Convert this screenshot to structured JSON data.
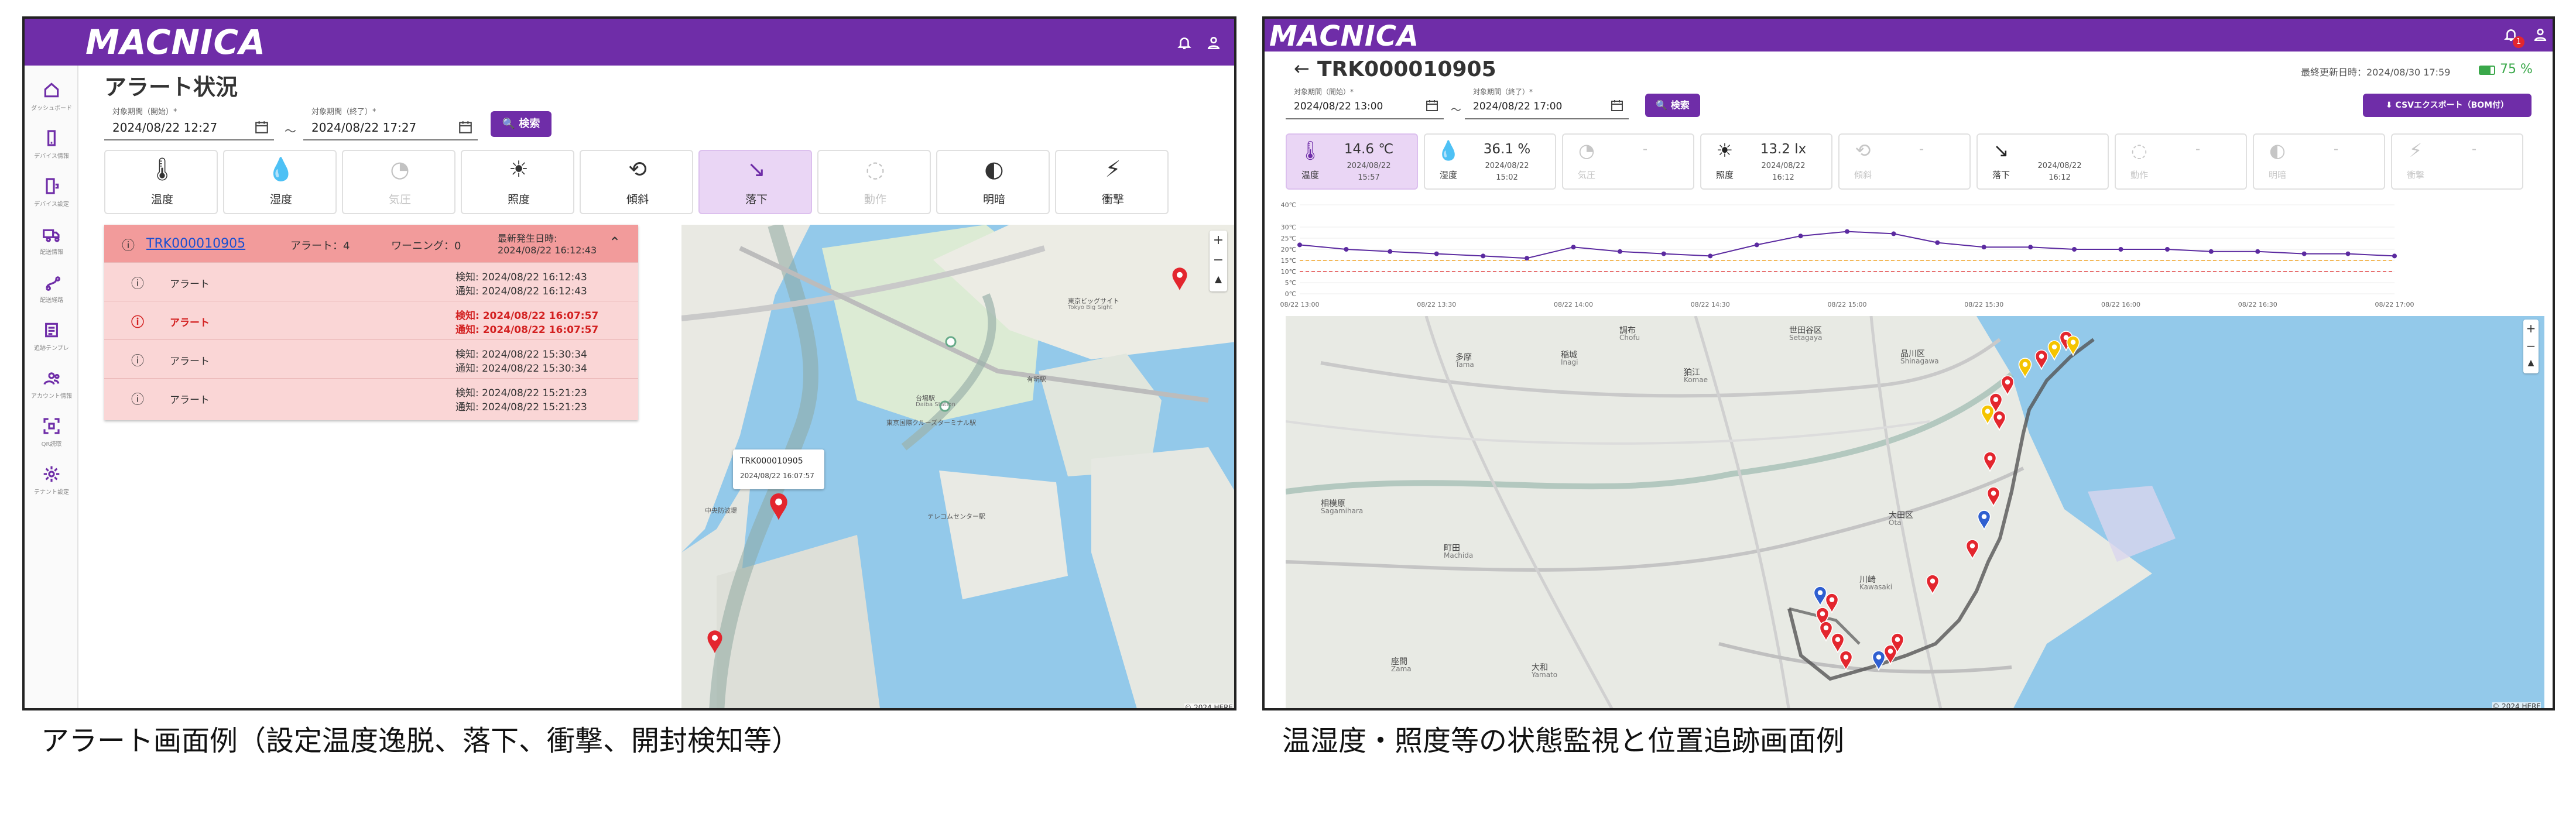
{
  "left": {
    "brand": "MACNICA",
    "page_title": "アラート状況",
    "sidebar": [
      {
        "label": "ダッシュボード",
        "icon": "home-icon"
      },
      {
        "label": "デバイス情報",
        "icon": "phone-icon"
      },
      {
        "label": "デバイス設定",
        "icon": "device-settings-icon"
      },
      {
        "label": "配送情報",
        "icon": "truck-icon"
      },
      {
        "label": "配送経路",
        "icon": "route-icon"
      },
      {
        "label": "追跡テンプレ",
        "icon": "template-icon"
      },
      {
        "label": "アカウント情報",
        "icon": "accounts-icon"
      },
      {
        "label": "QR読取",
        "icon": "qr-scan-icon"
      },
      {
        "label": "テナント設定",
        "icon": "gear-icon"
      }
    ],
    "start": {
      "label": "対象期間（開始）*",
      "value": "2024/08/22 12:27"
    },
    "end": {
      "label": "対象期間（終了）*",
      "value": "2024/08/22 17:27"
    },
    "tilde": "〜",
    "search_label": "検索",
    "tiles": [
      {
        "label": "温度",
        "glyph": "🌡",
        "icon": "thermometer-icon"
      },
      {
        "label": "湿度",
        "glyph": "💧",
        "icon": "humidity-icon"
      },
      {
        "label": "気圧",
        "glyph": "◔",
        "icon": "pressure-icon"
      },
      {
        "label": "照度",
        "glyph": "☀",
        "icon": "illuminance-icon"
      },
      {
        "label": "傾斜",
        "glyph": "⟲",
        "icon": "tilt-icon"
      },
      {
        "label": "落下",
        "glyph": "↘",
        "icon": "drop-icon"
      },
      {
        "label": "動作",
        "glyph": "◌",
        "icon": "motion-icon"
      },
      {
        "label": "明暗",
        "glyph": "◐",
        "icon": "light-dark-icon"
      },
      {
        "label": "衝撃",
        "glyph": "⚡",
        "icon": "shock-icon"
      }
    ],
    "alert": {
      "tracker": "TRK000010905",
      "alert_count": "アラート：4",
      "warning_count": "ワーニング：0",
      "latest_label": "最新発生日時:",
      "latest_value": "2024/08/22 16:12:43",
      "rows": [
        {
          "name": "アラート",
          "detect": "検知: 2024/08/22 16:12:43",
          "notify": "通知: 2024/08/22 16:12:43",
          "highlight": false
        },
        {
          "name": "アラート",
          "detect": "検知: 2024/08/22 16:07:57",
          "notify": "通知: 2024/08/22 16:07:57",
          "highlight": true
        },
        {
          "name": "アラート",
          "detect": "検知: 2024/08/22 15:30:34",
          "notify": "通知: 2024/08/22 15:30:34",
          "highlight": false
        },
        {
          "name": "アラート",
          "detect": "検知: 2024/08/22 15:21:23",
          "notify": "通知: 2024/08/22 15:21:23",
          "highlight": false
        }
      ]
    },
    "map": {
      "popup_title": "TRK000010905",
      "popup_time": "2024/08/22 16:07:57",
      "labels": [
        "台場駅",
        "Daiba Station",
        "東京ビッグサイト",
        "Tokyo Big Sight",
        "有明駅",
        "東京国際クルーズターミナル駅",
        "テレコムセンター駅",
        "中央防波堤"
      ],
      "attribution": "© 2024 HERE"
    },
    "caption": "アラート画面例（設定温度逸脱、落下、衝撃、開封検知等）"
  },
  "right": {
    "brand": "MACNICA",
    "tracker_title": "TRK000010905",
    "last_update": "最終更新日時：2024/08/30 17:59",
    "battery": "75 %",
    "notif_count": "1",
    "start": {
      "label": "対象期間（開始）*",
      "value": "2024/08/22 13:00"
    },
    "end": {
      "label": "対象期間（終了）*",
      "value": "2024/08/22 17:00"
    },
    "tilde": "〜",
    "search_label": "検索",
    "csv_label": "CSVエクスポート（BOM付）",
    "tiles": [
      {
        "name": "温度",
        "value": "14.6 ℃",
        "d1": "2024/08/22",
        "d2": "15:57",
        "glyph": "🌡",
        "icon": "thermometer-icon"
      },
      {
        "name": "湿度",
        "value": "36.1 %",
        "d1": "2024/08/22",
        "d2": "15:02",
        "glyph": "💧",
        "icon": "humidity-icon"
      },
      {
        "name": "気圧",
        "value": "-",
        "d1": "",
        "d2": "",
        "glyph": "◔",
        "icon": "pressure-icon"
      },
      {
        "name": "照度",
        "value": "13.2 lx",
        "d1": "2024/08/22",
        "d2": "16:12",
        "glyph": "☀",
        "icon": "illuminance-icon"
      },
      {
        "name": "傾斜",
        "value": "-",
        "d1": "",
        "d2": "",
        "glyph": "⟲",
        "icon": "tilt-icon"
      },
      {
        "name": "落下",
        "value": "",
        "d1": "2024/08/22",
        "d2": "16:12",
        "glyph": "↘",
        "icon": "drop-icon"
      },
      {
        "name": "動作",
        "value": "-",
        "d1": "",
        "d2": "",
        "glyph": "◌",
        "icon": "motion-icon"
      },
      {
        "name": "明暗",
        "value": "-",
        "d1": "",
        "d2": "",
        "glyph": "◐",
        "icon": "light-dark-icon"
      },
      {
        "name": "衝撃",
        "value": "-",
        "d1": "",
        "d2": "",
        "glyph": "⚡",
        "icon": "shock-icon"
      }
    ],
    "map_labels": [
      "多摩",
      "Tama",
      "稲城",
      "Inagi",
      "調布",
      "Chofu",
      "狛江",
      "Komae",
      "世田谷区",
      "Setagaya",
      "品川区",
      "Shinagawa",
      "大田区",
      "Ota",
      "川崎",
      "Kawasaki",
      "相模原",
      "Sagamihara",
      "町田",
      "Machida",
      "座間",
      "Zama",
      "大和",
      "Yamato"
    ],
    "attribution": "© 2024 HERE",
    "caption": "温湿度・照度等の状態監視と位置追跡画面例"
  },
  "chart_data": {
    "type": "line",
    "x_ticks": [
      "08/22 13:00",
      "08/22 13:30",
      "08/22 14:00",
      "08/22 14:30",
      "08/22 15:00",
      "08/22 15:30",
      "08/22 16:00",
      "08/22 16:30",
      "08/22 17:00"
    ],
    "y_ticks": [
      "40℃",
      "30℃",
      "25℃",
      "20℃",
      "15℃",
      "10℃",
      "5℃",
      "0℃"
    ],
    "ylim": [
      0,
      40
    ],
    "threshold_lines": [
      15,
      10
    ],
    "series": [
      {
        "x": [
          13.0,
          13.17,
          13.33,
          13.5,
          13.67,
          13.83,
          14.0,
          14.17,
          14.33,
          14.5,
          14.67,
          14.83,
          15.0,
          15.17,
          15.33,
          15.5,
          15.67,
          15.83,
          16.0,
          16.17,
          16.33,
          16.5,
          16.67,
          16.83,
          17.0
        ],
        "values": [
          22,
          20,
          19,
          18,
          17,
          16,
          21,
          19,
          18,
          17,
          22,
          26,
          28,
          27,
          23,
          21,
          21,
          20,
          20,
          20,
          19,
          19,
          18,
          18,
          17
        ]
      }
    ]
  }
}
